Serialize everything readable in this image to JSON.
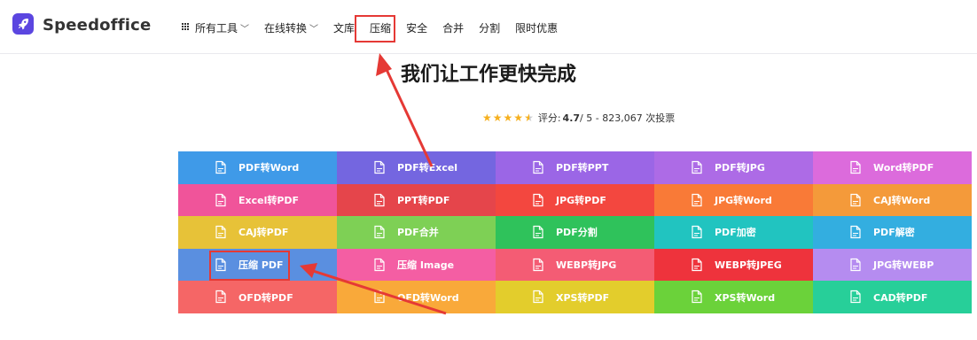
{
  "header": {
    "brand": "Speedoffice",
    "nav": [
      {
        "label": "所有工具",
        "has_grid_icon": true,
        "has_dropdown": true
      },
      {
        "label": "在线转换",
        "has_grid_icon": false,
        "has_dropdown": true
      },
      {
        "label": "文库",
        "has_grid_icon": false,
        "has_dropdown": false
      },
      {
        "label": "压缩",
        "has_grid_icon": false,
        "has_dropdown": false,
        "highlighted": true
      },
      {
        "label": "安全",
        "has_grid_icon": false,
        "has_dropdown": false
      },
      {
        "label": "合并",
        "has_grid_icon": false,
        "has_dropdown": false
      },
      {
        "label": "分割",
        "has_grid_icon": false,
        "has_dropdown": false
      },
      {
        "label": "限时优惠",
        "has_grid_icon": false,
        "has_dropdown": false
      }
    ]
  },
  "main": {
    "title": "我们让工作更快完成",
    "rating": {
      "stars": 4.5,
      "prefix": "评分: ",
      "score": "4.7",
      "suffix": " / 5 - 823,067 次投票"
    }
  },
  "tiles": [
    {
      "label": "PDF转Word",
      "color": "#3f9ae8"
    },
    {
      "label": "PDF转Excel",
      "color": "#7466e0"
    },
    {
      "label": "PDF转PPT",
      "color": "#9b66e6"
    },
    {
      "label": "PDF转JPG",
      "color": "#ad6be6"
    },
    {
      "label": "Word转PDF",
      "color": "#dc6bdc"
    },
    {
      "label": "Excel转PDF",
      "color": "#f0549a"
    },
    {
      "label": "PPT转PDF",
      "color": "#e5454b"
    },
    {
      "label": "JPG转PDF",
      "color": "#f3473f"
    },
    {
      "label": "JPG转Word",
      "color": "#f97a37"
    },
    {
      "label": "CAJ转Word",
      "color": "#f49a3a"
    },
    {
      "label": "CAJ转PDF",
      "color": "#e7c238"
    },
    {
      "label": "PDF合并",
      "color": "#7ed055"
    },
    {
      "label": "PDF分割",
      "color": "#2fc25b"
    },
    {
      "label": "PDF加密",
      "color": "#21c4c0"
    },
    {
      "label": "PDF解密",
      "color": "#33aee0"
    },
    {
      "label": "压缩 PDF",
      "color": "#5a8fe0",
      "highlighted": true
    },
    {
      "label": "压缩 Image",
      "color": "#f45ea3"
    },
    {
      "label": "WEBP转JPG",
      "color": "#f45c74"
    },
    {
      "label": "WEBP转JPEG",
      "color": "#ee333c"
    },
    {
      "label": "JPG转WEBP",
      "color": "#b58cf0"
    },
    {
      "label": "OFD转PDF",
      "color": "#f56666"
    },
    {
      "label": "OFD转Word",
      "color": "#f9a93a"
    },
    {
      "label": "XPS转PDF",
      "color": "#e3cd2c"
    },
    {
      "label": "XPS转Word",
      "color": "#6bd23a"
    },
    {
      "label": "CAD转PDF",
      "color": "#27cf99"
    }
  ],
  "annotations": {
    "color": "#e53935",
    "icons": [
      "rocket-icon",
      "grid-icon",
      "chevron-down-icon",
      "star-icon",
      "file-icon"
    ]
  }
}
